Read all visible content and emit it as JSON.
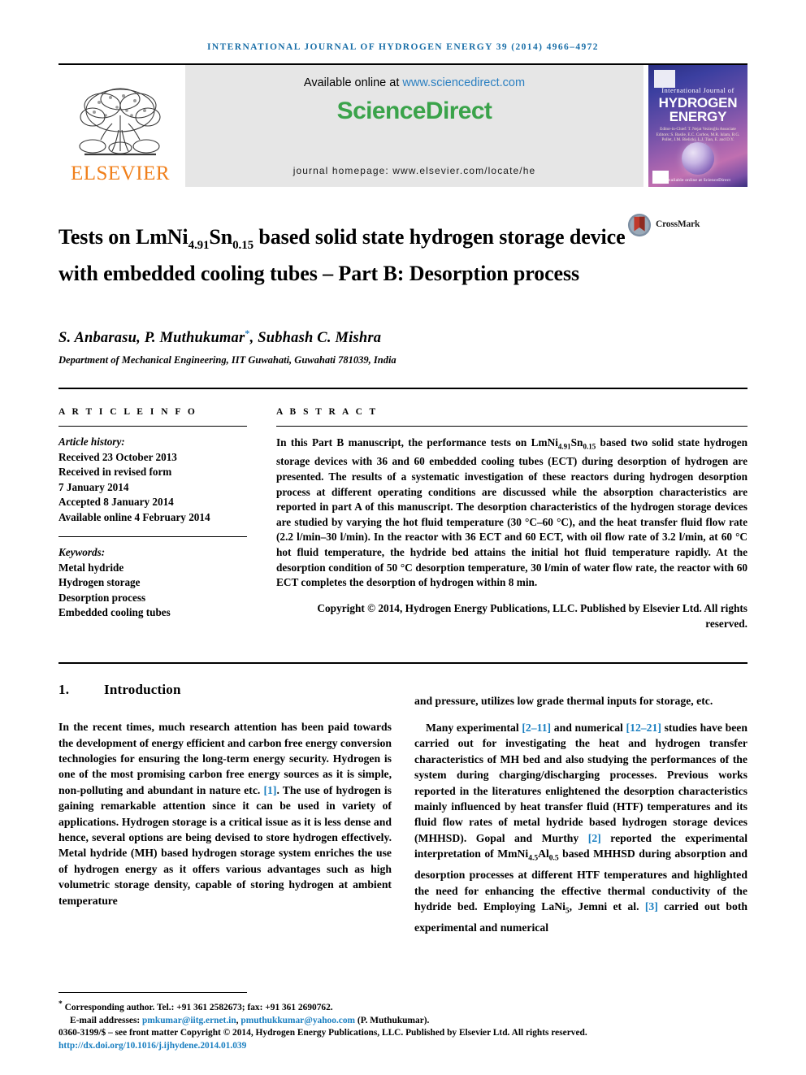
{
  "running_head": "International Journal of Hydrogen Energy 39 (2014) 4966–4972",
  "masthead": {
    "publisher_name": "ELSEVIER",
    "available_text": "Available online at ",
    "available_url": "www.sciencedirect.com",
    "sciencedirect_science": "Science",
    "sciencedirect_direct": "Direct",
    "journal_homepage": "journal homepage: www.elsevier.com/locate/he",
    "cover": {
      "line1": "International Journal of",
      "line2": "HYDROGEN",
      "line3": "ENERGY",
      "editors": "Editor-in-Chief:  T. Nejat Veziroğlu\nAssociate Editors:  S. Basile, E.C. Corbos, M.R. Islam,\nB.G. Pollet, J.M. Bielicki,\nL.J. Tian, E. and D.Y. Goswami",
      "bottom": "Available online at ScienceDirect"
    }
  },
  "article": {
    "title_line1_pre": "Tests on LmNi",
    "title_sub1": "4.91",
    "title_mid1": "Sn",
    "title_sub2": "0.15",
    "title_post": " based solid state hydrogen storage device with embedded cooling tubes – Part B: Desorption process",
    "crossmark_label": "CrossMark",
    "authors": "S. Anbarasu, P. Muthukumar",
    "authors_marker": "*",
    "authors_tail": ", Subhash C. Mishra",
    "affiliation": "Department of Mechanical Engineering, IIT Guwahati, Guwahati 781039, India"
  },
  "article_info": {
    "heading": "A R T I C L E   I N F O",
    "history_label": "Article history:",
    "history": [
      "Received 23 October 2013",
      "Received in revised form",
      "7 January 2014",
      "Accepted 8 January 2014",
      "Available online 4 February 2014"
    ],
    "keywords_label": "Keywords:",
    "keywords": [
      "Metal hydride",
      "Hydrogen storage",
      "Desorption process",
      "Embedded cooling tubes"
    ]
  },
  "abstract": {
    "heading": "A B S T R A C T",
    "part1": "In this Part B manuscript, the performance tests on LmNi",
    "sub1": "4.91",
    "mid1": "Sn",
    "sub2": "0.15",
    "part2": " based two solid state hydrogen storage devices with 36 and 60 embedded cooling tubes (ECT) during desorption of hydrogen are presented. The results of a systematic investigation of these reactors during hydrogen desorption process at different operating conditions are discussed while the absorption characteristics are reported in part A of this manuscript. The desorption characteristics of the hydrogen storage devices are studied by varying the hot fluid temperature (30 °C–60 °C), and the heat transfer fluid flow rate (2.2 l/min–30 l/min). In the reactor with 36 ECT and 60 ECT, with oil flow rate of 3.2 l/min, at 60 °C hot fluid temperature, the hydride bed attains the initial hot fluid temperature rapidly. At the desorption condition of 50 °C desorption temperature, 30 l/min of water flow rate, the reactor with 60 ECT completes the desorption of hydrogen within 8 min.",
    "copyright": "Copyright © 2014, Hydrogen Energy Publications, LLC. Published by Elsevier Ltd. All rights reserved."
  },
  "body": {
    "section_number": "1.",
    "section_title": "Introduction",
    "left_para_1_a": "In the recent times, much research attention has been paid towards the development of energy efficient and carbon free energy conversion technologies for ensuring the long-term energy security. Hydrogen is one of the most promising carbon free energy sources as it is simple, non-polluting and abundant in nature etc. ",
    "left_ref_1": "[1]",
    "left_para_1_b": ". The use of hydrogen is gaining remarkable attention since it can be used in variety of applications. Hydrogen storage is a critical issue as it is less dense and hence, several options are being devised to store hydrogen effectively. Metal hydride (MH) based hydrogen storage system enriches the use of hydrogen energy as it offers various advantages such as high volumetric storage density, capable of storing hydrogen at ambient temperature",
    "right_para_1": "and pressure, utilizes low grade thermal inputs for storage, etc.",
    "right_para_2_a": "Many experimental ",
    "right_ref_2_11": "[2–11]",
    "right_para_2_b": " and numerical ",
    "right_ref_12_21": "[12–21]",
    "right_para_2_c": " studies have been carried out for investigating the heat and hydrogen transfer characteristics of MH bed and also studying the performances of the system during charging/discharging processes. Previous works reported in the literatures enlightened the desorption characteristics mainly influenced by heat transfer fluid (HTF) temperatures and its fluid flow rates of metal hydride based hydrogen storage devices (MHHSD). Gopal and Murthy ",
    "right_ref_2": "[2]",
    "right_para_2_d": " reported the experimental interpretation of MmNi",
    "right_sub_45": "4.5",
    "right_mid_al": "Al",
    "right_sub_05": "0.5",
    "right_para_2_e": " based MHHSD during absorption and desorption processes at different HTF temperatures and highlighted the need for enhancing the effective thermal conductivity of the hydride bed. Employing LaNi",
    "right_sub_5": "5",
    "right_para_2_f": ", Jemni et al. ",
    "right_ref_3": "[3]",
    "right_para_2_g": " carried out both experimental and numerical"
  },
  "footer": {
    "corresponding_marker": "*",
    "corresponding": " Corresponding author. Tel.: +91 361 2582673; fax: +91 361 2690762.",
    "email_label": "E-mail addresses: ",
    "email_1": "pmkumar@iitg.ernet.in",
    "email_sep": ", ",
    "email_2": "pmuthukkumar@yahoo.com",
    "email_tail": " (P. Muthukumar).",
    "issn_line": "0360-3199/$ – see front matter Copyright © 2014, Hydrogen Energy Publications, LLC. Published by Elsevier Ltd. All rights reserved.",
    "doi": "http://dx.doi.org/10.1016/j.ijhydene.2014.01.039"
  },
  "colors": {
    "link_blue": "#1a7fc1",
    "elsevier_orange": "#f07f1a",
    "sciencedirect_green": "#3aa34a"
  }
}
